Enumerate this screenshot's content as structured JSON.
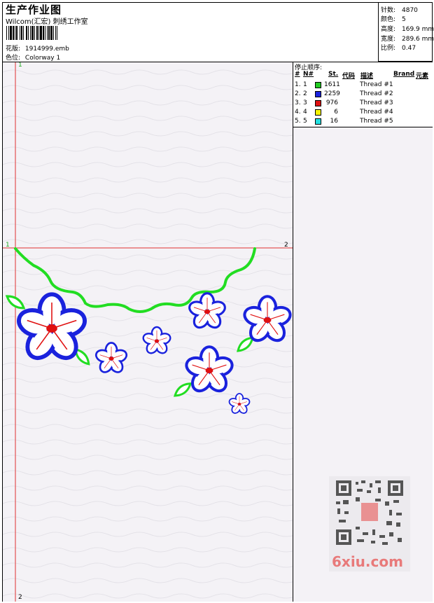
{
  "header": {
    "title": "生产作业图",
    "company": "Wilcom(汇宏) 刺绣工作室",
    "design_label": "花版:",
    "design_value": "1914999.emb",
    "colorway_label": "色位:",
    "colorway_value": "Colorway 1"
  },
  "stats": [
    {
      "label": "针数:",
      "value": "4870"
    },
    {
      "label": "颜色:",
      "value": "5"
    },
    {
      "label": "高度:",
      "value": "169.9 mm"
    },
    {
      "label": "宽度:",
      "value": "289.6 mm"
    },
    {
      "label": "比例:",
      "value": "0.47"
    }
  ],
  "stop_sequence": {
    "title": "停止顺序:",
    "columns": [
      "#",
      "N#",
      "St.",
      "代码",
      "描述",
      "Brand",
      "元素"
    ],
    "rows": [
      {
        "num": "1.",
        "n": "1",
        "color": "#22cc22",
        "stitches": "1611",
        "desc": "Thread #1"
      },
      {
        "num": "2.",
        "n": "2",
        "color": "#1a22dd",
        "stitches": "2259",
        "desc": "Thread #2"
      },
      {
        "num": "3.",
        "n": "3",
        "color": "#e01010",
        "stitches": "976",
        "desc": "Thread #3"
      },
      {
        "num": "4.",
        "n": "4",
        "color": "#f5f500",
        "stitches": "6",
        "desc": "Thread #4"
      },
      {
        "num": "5.",
        "n": "5",
        "color": "#22e0e0",
        "stitches": "16",
        "desc": "Thread #5"
      }
    ]
  },
  "guides": {
    "v_top": "1",
    "v_bottom": "2",
    "h_left": "1",
    "h_right": "2"
  },
  "watermark": "6xiu.com",
  "colors": {
    "guide_line": "#e03030",
    "guide_label": "#22aa22",
    "outline_green": "#22dd22",
    "outline_blue": "#1a22dd",
    "center_red": "#e01010"
  }
}
